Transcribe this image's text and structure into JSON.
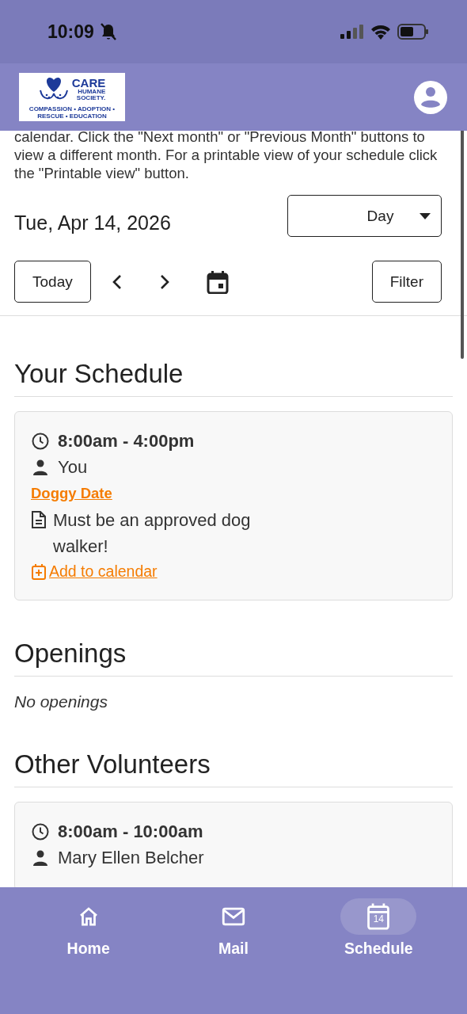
{
  "status_bar": {
    "time": "10:09"
  },
  "header": {
    "logo": {
      "line_1": "CARE",
      "line_2": "HUMANE",
      "line_3": "SOCIETY.",
      "tagline": "COMPASSION • ADOPTION • RESCUE • EDUCATION"
    }
  },
  "intro": "calendar. Click the \"Next month\" or \"Previous Month\" buttons to view a different month. For a printable view of your schedule click the \"Printable view\" button.",
  "date_label": "Tue, Apr 14, 2026",
  "view_select": {
    "value": "Day"
  },
  "toolbar": {
    "today": "Today",
    "filter": "Filter"
  },
  "sections": [
    {
      "title": "Your Schedule",
      "shifts": [
        {
          "time": "8:00am - 4:00pm",
          "person": "You",
          "activity": "Doggy Date",
          "note": "Must be an approved dog walker!",
          "add_link": "Add to calendar"
        }
      ]
    },
    {
      "title": "Openings",
      "empty_text": "No openings"
    },
    {
      "title": "Other Volunteers",
      "shifts": [
        {
          "time": "8:00am - 10:00am",
          "person": "Mary Ellen Belcher"
        }
      ]
    }
  ],
  "nav": [
    {
      "kind": "home",
      "label": "Home",
      "selected": false
    },
    {
      "kind": "mail",
      "label": "Mail",
      "selected": false
    },
    {
      "kind": "calendar",
      "label": "Schedule",
      "badge": "14",
      "selected": true
    }
  ]
}
